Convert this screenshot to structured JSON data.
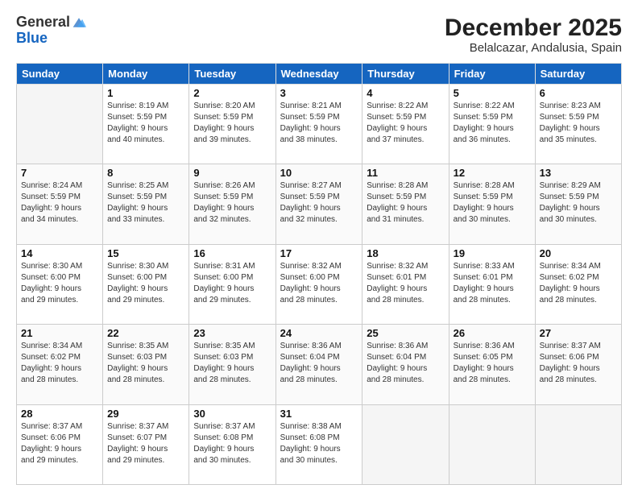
{
  "logo": {
    "general": "General",
    "blue": "Blue"
  },
  "title": "December 2025",
  "location": "Belalcazar, Andalusia, Spain",
  "weekdays": [
    "Sunday",
    "Monday",
    "Tuesday",
    "Wednesday",
    "Thursday",
    "Friday",
    "Saturday"
  ],
  "weeks": [
    [
      {
        "day": "",
        "details": ""
      },
      {
        "day": "1",
        "details": "Sunrise: 8:19 AM\nSunset: 5:59 PM\nDaylight: 9 hours\nand 40 minutes."
      },
      {
        "day": "2",
        "details": "Sunrise: 8:20 AM\nSunset: 5:59 PM\nDaylight: 9 hours\nand 39 minutes."
      },
      {
        "day": "3",
        "details": "Sunrise: 8:21 AM\nSunset: 5:59 PM\nDaylight: 9 hours\nand 38 minutes."
      },
      {
        "day": "4",
        "details": "Sunrise: 8:22 AM\nSunset: 5:59 PM\nDaylight: 9 hours\nand 37 minutes."
      },
      {
        "day": "5",
        "details": "Sunrise: 8:22 AM\nSunset: 5:59 PM\nDaylight: 9 hours\nand 36 minutes."
      },
      {
        "day": "6",
        "details": "Sunrise: 8:23 AM\nSunset: 5:59 PM\nDaylight: 9 hours\nand 35 minutes."
      }
    ],
    [
      {
        "day": "7",
        "details": "Sunrise: 8:24 AM\nSunset: 5:59 PM\nDaylight: 9 hours\nand 34 minutes."
      },
      {
        "day": "8",
        "details": "Sunrise: 8:25 AM\nSunset: 5:59 PM\nDaylight: 9 hours\nand 33 minutes."
      },
      {
        "day": "9",
        "details": "Sunrise: 8:26 AM\nSunset: 5:59 PM\nDaylight: 9 hours\nand 32 minutes."
      },
      {
        "day": "10",
        "details": "Sunrise: 8:27 AM\nSunset: 5:59 PM\nDaylight: 9 hours\nand 32 minutes."
      },
      {
        "day": "11",
        "details": "Sunrise: 8:28 AM\nSunset: 5:59 PM\nDaylight: 9 hours\nand 31 minutes."
      },
      {
        "day": "12",
        "details": "Sunrise: 8:28 AM\nSunset: 5:59 PM\nDaylight: 9 hours\nand 30 minutes."
      },
      {
        "day": "13",
        "details": "Sunrise: 8:29 AM\nSunset: 5:59 PM\nDaylight: 9 hours\nand 30 minutes."
      }
    ],
    [
      {
        "day": "14",
        "details": "Sunrise: 8:30 AM\nSunset: 6:00 PM\nDaylight: 9 hours\nand 29 minutes."
      },
      {
        "day": "15",
        "details": "Sunrise: 8:30 AM\nSunset: 6:00 PM\nDaylight: 9 hours\nand 29 minutes."
      },
      {
        "day": "16",
        "details": "Sunrise: 8:31 AM\nSunset: 6:00 PM\nDaylight: 9 hours\nand 29 minutes."
      },
      {
        "day": "17",
        "details": "Sunrise: 8:32 AM\nSunset: 6:00 PM\nDaylight: 9 hours\nand 28 minutes."
      },
      {
        "day": "18",
        "details": "Sunrise: 8:32 AM\nSunset: 6:01 PM\nDaylight: 9 hours\nand 28 minutes."
      },
      {
        "day": "19",
        "details": "Sunrise: 8:33 AM\nSunset: 6:01 PM\nDaylight: 9 hours\nand 28 minutes."
      },
      {
        "day": "20",
        "details": "Sunrise: 8:34 AM\nSunset: 6:02 PM\nDaylight: 9 hours\nand 28 minutes."
      }
    ],
    [
      {
        "day": "21",
        "details": "Sunrise: 8:34 AM\nSunset: 6:02 PM\nDaylight: 9 hours\nand 28 minutes."
      },
      {
        "day": "22",
        "details": "Sunrise: 8:35 AM\nSunset: 6:03 PM\nDaylight: 9 hours\nand 28 minutes."
      },
      {
        "day": "23",
        "details": "Sunrise: 8:35 AM\nSunset: 6:03 PM\nDaylight: 9 hours\nand 28 minutes."
      },
      {
        "day": "24",
        "details": "Sunrise: 8:36 AM\nSunset: 6:04 PM\nDaylight: 9 hours\nand 28 minutes."
      },
      {
        "day": "25",
        "details": "Sunrise: 8:36 AM\nSunset: 6:04 PM\nDaylight: 9 hours\nand 28 minutes."
      },
      {
        "day": "26",
        "details": "Sunrise: 8:36 AM\nSunset: 6:05 PM\nDaylight: 9 hours\nand 28 minutes."
      },
      {
        "day": "27",
        "details": "Sunrise: 8:37 AM\nSunset: 6:06 PM\nDaylight: 9 hours\nand 28 minutes."
      }
    ],
    [
      {
        "day": "28",
        "details": "Sunrise: 8:37 AM\nSunset: 6:06 PM\nDaylight: 9 hours\nand 29 minutes."
      },
      {
        "day": "29",
        "details": "Sunrise: 8:37 AM\nSunset: 6:07 PM\nDaylight: 9 hours\nand 29 minutes."
      },
      {
        "day": "30",
        "details": "Sunrise: 8:37 AM\nSunset: 6:08 PM\nDaylight: 9 hours\nand 30 minutes."
      },
      {
        "day": "31",
        "details": "Sunrise: 8:38 AM\nSunset: 6:08 PM\nDaylight: 9 hours\nand 30 minutes."
      },
      {
        "day": "",
        "details": ""
      },
      {
        "day": "",
        "details": ""
      },
      {
        "day": "",
        "details": ""
      }
    ]
  ]
}
